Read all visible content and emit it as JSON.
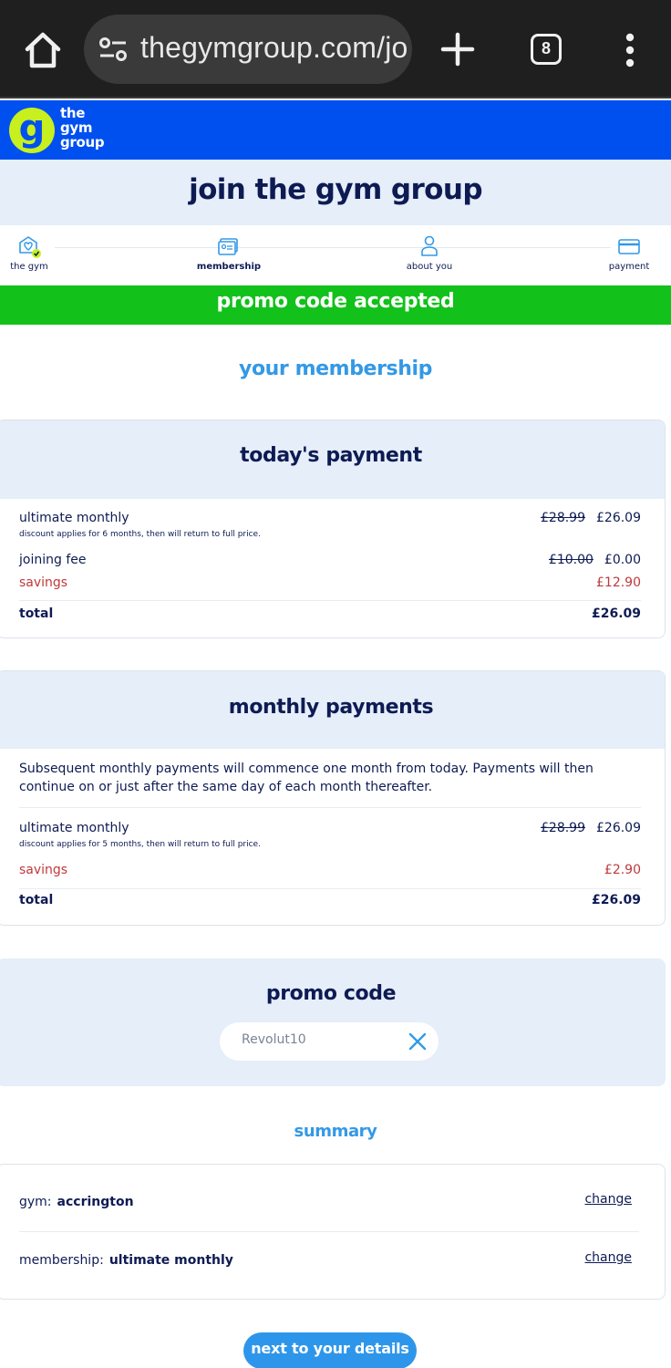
{
  "browser": {
    "url": "thegymgroup.com/jo",
    "tab_count": "8",
    "icons": [
      "home-icon",
      "tune-icon",
      "plus-icon",
      "tabs-icon",
      "more-vert-icon"
    ]
  },
  "site": {
    "logo_line1": "the",
    "logo_line2": "gym",
    "logo_line3": "group",
    "brand_color": "#0050f0",
    "logo_accent": "#c8ef1e"
  },
  "page": {
    "title": "join the gym group"
  },
  "steps": [
    {
      "label": "the gym",
      "icon": "gym-heart-icon",
      "completed": true
    },
    {
      "label": "membership",
      "icon": "membership-card-icon",
      "active": true
    },
    {
      "label": "about you",
      "icon": "person-icon"
    },
    {
      "label": "payment",
      "icon": "credit-card-icon"
    }
  ],
  "promo_banner": {
    "text": "promo code accepted",
    "color": "#12c11a"
  },
  "membership": {
    "heading": "your membership"
  },
  "todays_payment": {
    "title": "today's payment",
    "item_label": "ultimate monthly",
    "item_note": "discount applies for 6 months, then will return to full price.",
    "item_old_price": "£28.99",
    "item_price": "£26.09",
    "fee_label": "joining fee",
    "fee_old_price": "£10.00",
    "fee_price": "£0.00",
    "savings_label": "savings",
    "savings_value": "£12.90",
    "total_label": "total",
    "total_value": "£26.09"
  },
  "monthly_payments": {
    "title": "monthly payments",
    "description": "Subsequent monthly payments will commence one month from today. Payments will then continue on or just after the same day of each month thereafter.",
    "item_label": "ultimate monthly",
    "item_note": "discount applies for 5 months, then will return to full price.",
    "item_old_price": "£28.99",
    "item_price": "£26.09",
    "savings_label": "savings",
    "savings_value": "£2.90",
    "total_label": "total",
    "total_value": "£26.09"
  },
  "promo_code": {
    "title": "promo code",
    "value": "Revolut10"
  },
  "summary": {
    "heading": "summary",
    "gym_key": "gym:",
    "gym_value": "accrington",
    "membership_key": "membership:",
    "membership_value": "ultimate monthly",
    "change_label": "change"
  },
  "next_button": {
    "label": "next to your details"
  },
  "colors": {
    "navy": "#0e1b53",
    "accent_blue": "#3399e6",
    "savings_red": "#c0393b",
    "light_panel": "#e5eef9"
  }
}
